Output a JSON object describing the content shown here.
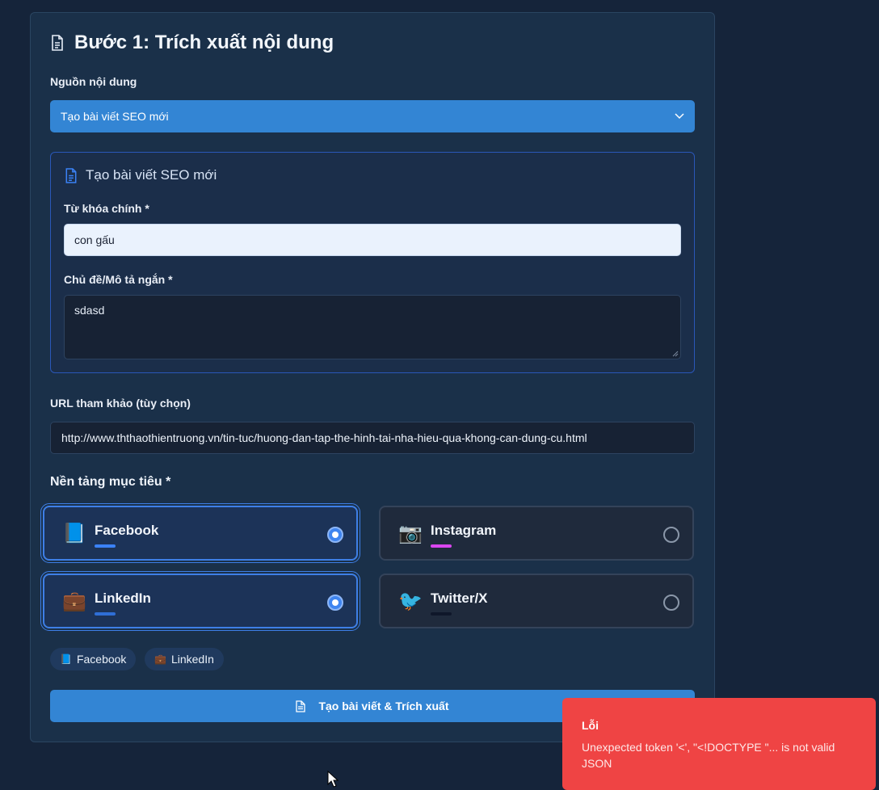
{
  "step": {
    "title": "Bước 1: Trích xuất nội dung"
  },
  "source": {
    "label": "Nguồn nội dung",
    "selected": "Tạo bài viết SEO mới"
  },
  "seo_panel": {
    "heading": "Tạo bài viết SEO mới",
    "keyword_label": "Từ khóa chính *",
    "keyword_value": "con gấu",
    "topic_label": "Chủ đề/Mô tả ngắn *",
    "topic_value": "sdasd"
  },
  "reference_url": {
    "label": "URL tham khảo (tùy chọn)",
    "value": "http://www.ththaothientruong.vn/tin-tuc/huong-dan-tap-the-hinh-tai-nha-hieu-qua-khong-can-dung-cu.html"
  },
  "platforms": {
    "heading": "Nền tảng mục tiêu *",
    "items": [
      {
        "name": "Facebook",
        "emoji": "📘",
        "accent": "#3b82f6",
        "selected": true
      },
      {
        "name": "Instagram",
        "emoji": "📷",
        "accent": "#d946ef",
        "selected": false
      },
      {
        "name": "LinkedIn",
        "emoji": "💼",
        "accent": "#2f6fd6",
        "selected": true
      },
      {
        "name": "Twitter/X",
        "emoji": "🐦",
        "accent": "#0f172a",
        "selected": false
      }
    ],
    "chips": [
      {
        "emoji": "📘",
        "label": "Facebook"
      },
      {
        "emoji": "💼",
        "label": "LinkedIn"
      }
    ]
  },
  "submit": {
    "label": "Tạo bài viết & Trích xuất"
  },
  "toast": {
    "title": "Lỗi",
    "message": "Unexpected token '<', \"<!DOCTYPE \"... is not valid JSON"
  },
  "colors": {
    "background": "#15243a",
    "card": "#1a3049",
    "primary": "#3385d4",
    "error": "#ef4444"
  }
}
